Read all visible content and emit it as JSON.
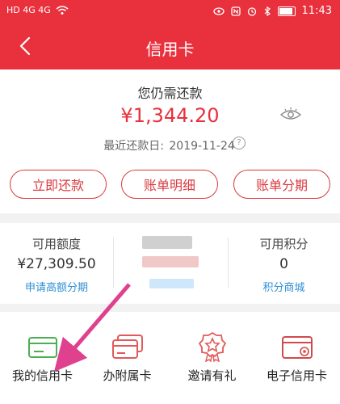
{
  "status_bar": {
    "left_text": "HD 4G 4G",
    "time": "11:43"
  },
  "header": {
    "title": "信用卡"
  },
  "balance": {
    "title": "您仍需还款",
    "amount": "¥1,344.20",
    "due_label": "最近还款日:",
    "due_date": "2019-11-24"
  },
  "actions": [
    {
      "label": "立即还款"
    },
    {
      "label": "账单明细"
    },
    {
      "label": "账单分期"
    }
  ],
  "credit_info": {
    "available_label": "可用额度",
    "available_value": "¥27,309.50",
    "available_link": "申请高额分期",
    "points_label": "可用积分",
    "points_value": "0",
    "points_link": "积分商城"
  },
  "bottom_items": [
    {
      "label": "我的信用卡",
      "icon": "card-green-icon"
    },
    {
      "label": "办附属卡",
      "icon": "cards-stack-icon"
    },
    {
      "label": "邀请有礼",
      "icon": "badge-star-icon"
    },
    {
      "label": "电子信用卡",
      "icon": "card-at-icon"
    }
  ],
  "colors": {
    "brand_red": "#e8313d",
    "link_blue": "#2d8fd5",
    "annotation_pink": "#e0418f"
  }
}
